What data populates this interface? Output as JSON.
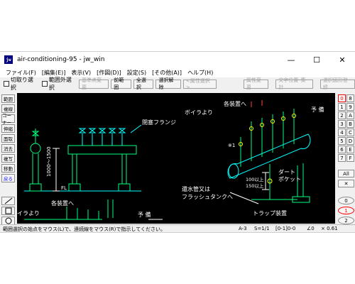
{
  "window": {
    "app_icon": "jw",
    "title": "air-conditioning-95 - jw_win",
    "minimize": "—",
    "maximize": "☐",
    "close": "✕"
  },
  "menu": [
    "ファイル(F)",
    "[編集(E)]",
    "表示(V)",
    "[作図(D)]",
    "設定(S)",
    "[その他(A)]",
    "ヘルプ(H)"
  ],
  "toolbar": {
    "crop_select": "切取り選択",
    "outside_select": "範囲外選択",
    "base_point_change": "基準点変更",
    "prev_range": "前範囲",
    "select_all": "全選択",
    "deselect": "選択解除",
    "attr_select": "<属性選択>",
    "attr_change": "属性変更",
    "text_pos": "文字位置･集計",
    "register": "選択図形登録"
  },
  "left_tools": [
    "範囲",
    "複線",
    "コーナー",
    "伸縮",
    "面取",
    "消去",
    "複写",
    "移動",
    "戻る"
  ],
  "right_tools": {
    "layer_groups": [
      "0",
      "1",
      "2",
      "3",
      "4",
      "5",
      "6",
      "7",
      "8",
      "9",
      "A",
      "B",
      "C",
      "D",
      "E",
      "F"
    ],
    "all": "All",
    "cross": "✕",
    "nums": [
      "0",
      "1",
      "2"
    ],
    "slash": "/"
  },
  "drawing_labels": {
    "flange": "閉塞フランジ",
    "boiler_top": "ボイラより",
    "to_devices_top": "各装置へ",
    "spare_top": "予 備",
    "note": "※1",
    "dirt_pocket_1": "ダート",
    "dirt_pocket_2": "ポケット",
    "dim_1": "100以上",
    "dim_2": "150以上",
    "return_1": "還水管又は",
    "return_2": "フラッシュタンクへ",
    "trap": "トラップ装置",
    "fl": "FL",
    "height": "1000～1500",
    "to_devices_bottom": "各装置へ",
    "boiler_bottom": "イラより",
    "spare_bottom": "予 備"
  },
  "status": {
    "message": "範囲選択の始点をマウス(L)で、連続線をマウス(R)で指示してください。",
    "paper": "A-3",
    "scale": "S=1/1",
    "layer": "[0-1]0-0",
    "angle": "∠0",
    "zoom": "× 0.61"
  }
}
